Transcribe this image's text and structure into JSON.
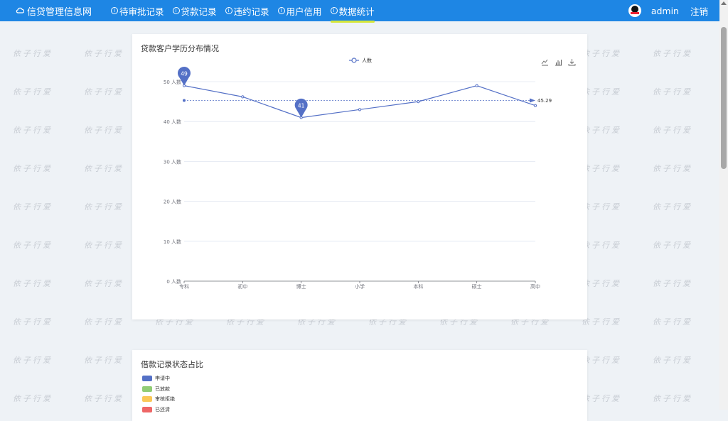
{
  "nav": {
    "brand": "信贷管理信息网",
    "items": [
      {
        "label": "待审批记录"
      },
      {
        "label": "贷款记录"
      },
      {
        "label": "违约记录"
      },
      {
        "label": "用户信用"
      },
      {
        "label": "数据统计"
      }
    ],
    "active_index": 4,
    "username": "admin",
    "logout": "注销"
  },
  "watermark_text": "依子行爱",
  "edu_chart": {
    "title": "贷款客户学历分布情况",
    "chart_data": {
      "type": "line",
      "categories": [
        "专科",
        "初中",
        "博士",
        "小学",
        "本科",
        "硕士",
        "高中"
      ],
      "series": [
        {
          "name": "人数",
          "values": [
            49,
            46.2,
            41,
            43,
            45,
            49,
            44
          ]
        }
      ],
      "ylim": [
        0,
        50
      ],
      "yticks": [
        0,
        10,
        20,
        30,
        40,
        50
      ],
      "y_unit_label": "人数",
      "yticks_labels": [
        "0 人数",
        "10 人数",
        "20 人数",
        "30 人数",
        "40 人数",
        "50 人数"
      ],
      "mark_points": [
        {
          "category": "专科",
          "value": 49,
          "label": "49"
        },
        {
          "category": "博士",
          "value": 41,
          "label": "41"
        }
      ],
      "mark_line": {
        "type": "average",
        "value": 45.29,
        "label": "45.29"
      },
      "grid": true,
      "legend": "top-center",
      "color": "#5470c6"
    }
  },
  "status_chart": {
    "title": "借款记录状态占比",
    "legend": [
      {
        "label": "申请中",
        "color": "#5470c6"
      },
      {
        "label": "已放款",
        "color": "#91cc75"
      },
      {
        "label": "审核拒绝",
        "color": "#fac858"
      },
      {
        "label": "已还清",
        "color": "#ee6666"
      }
    ]
  }
}
